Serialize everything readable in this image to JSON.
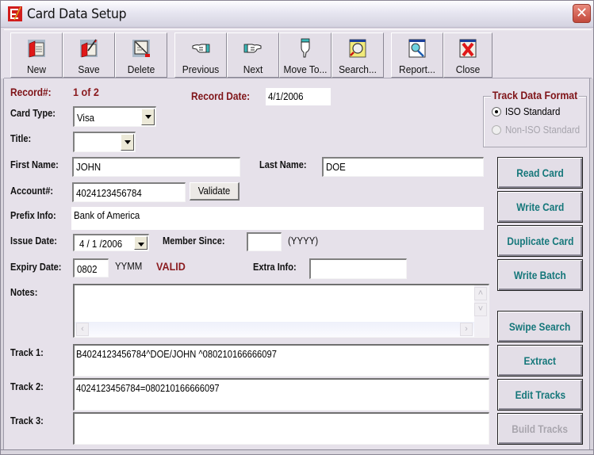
{
  "window": {
    "title": "Card Data Setup",
    "close_glyph": "✕"
  },
  "toolbar": {
    "buttons": [
      {
        "id": "new",
        "label": "New",
        "icon": "new-record-icon"
      },
      {
        "id": "save",
        "label": "Save",
        "icon": "save-record-icon"
      },
      {
        "id": "delete",
        "label": "Delete",
        "icon": "delete-record-icon"
      },
      {
        "id": "previous",
        "label": "Previous",
        "icon": "pointing-hand-left-icon"
      },
      {
        "id": "next",
        "label": "Next",
        "icon": "pointing-hand-right-icon"
      },
      {
        "id": "move_to",
        "label": "Move To...",
        "icon": "pointing-hand-down-icon"
      },
      {
        "id": "search",
        "label": "Search...",
        "icon": "search-document-icon"
      },
      {
        "id": "report",
        "label": "Report...",
        "icon": "report-magnifier-icon"
      },
      {
        "id": "close",
        "label": "Close",
        "icon": "close-red-x-icon"
      }
    ]
  },
  "form": {
    "record_label": "Record#:",
    "record_value": "1 of 2",
    "record_date_label": "Record Date:",
    "record_date_value": "4/1/2006",
    "card_type_label": "Card Type:",
    "card_type_value": "Visa",
    "title_label": "Title:",
    "title_value": "",
    "first_name_label": "First Name:",
    "first_name_value": "JOHN",
    "last_name_label": "Last Name:",
    "last_name_value": "DOE",
    "account_label": "Account#:",
    "account_value": "4024123456784",
    "validate_label": "Validate",
    "prefix_label": "Prefix Info:",
    "prefix_value": "Bank of America",
    "issue_date_label": "Issue Date:",
    "issue_date_value": "4 / 1 /2006",
    "member_since_label": "Member Since:",
    "member_since_value": "",
    "member_since_hint": "(YYYY)",
    "expiry_label": "Expiry Date:",
    "expiry_value": "0802",
    "expiry_hint": "YYMM",
    "expiry_status": "VALID",
    "extra_info_label": "Extra Info:",
    "extra_info_value": "",
    "notes_label": "Notes:",
    "notes_value": "",
    "track1_label": "Track 1:",
    "track1_value": "B4024123456784^DOE/JOHN ^080210166666097",
    "track2_label": "Track 2:",
    "track2_value": "4024123456784=080210166666097",
    "track3_label": "Track 3:",
    "track3_value": ""
  },
  "track_format": {
    "legend": "Track Data Format",
    "options": [
      {
        "label": "ISO Standard",
        "selected": true,
        "enabled": true
      },
      {
        "label": "Non-ISO Standard",
        "selected": false,
        "enabled": false
      }
    ]
  },
  "actions": {
    "buttons": [
      {
        "label": "Read Card",
        "enabled": true
      },
      {
        "label": "Write Card",
        "enabled": true
      },
      {
        "label": "Duplicate Card",
        "enabled": true
      },
      {
        "label": "Write Batch",
        "enabled": true
      },
      {
        "label": "Swipe Search",
        "enabled": true
      },
      {
        "label": "Extract",
        "enabled": true
      },
      {
        "label": "Edit Tracks",
        "enabled": true
      },
      {
        "label": "Build Tracks",
        "enabled": false
      }
    ]
  },
  "colors": {
    "label_red": "#7f1418",
    "action_teal": "#15777a",
    "disabled_gray": "#a9a6ae",
    "window_bg": "#e6e1ea"
  }
}
